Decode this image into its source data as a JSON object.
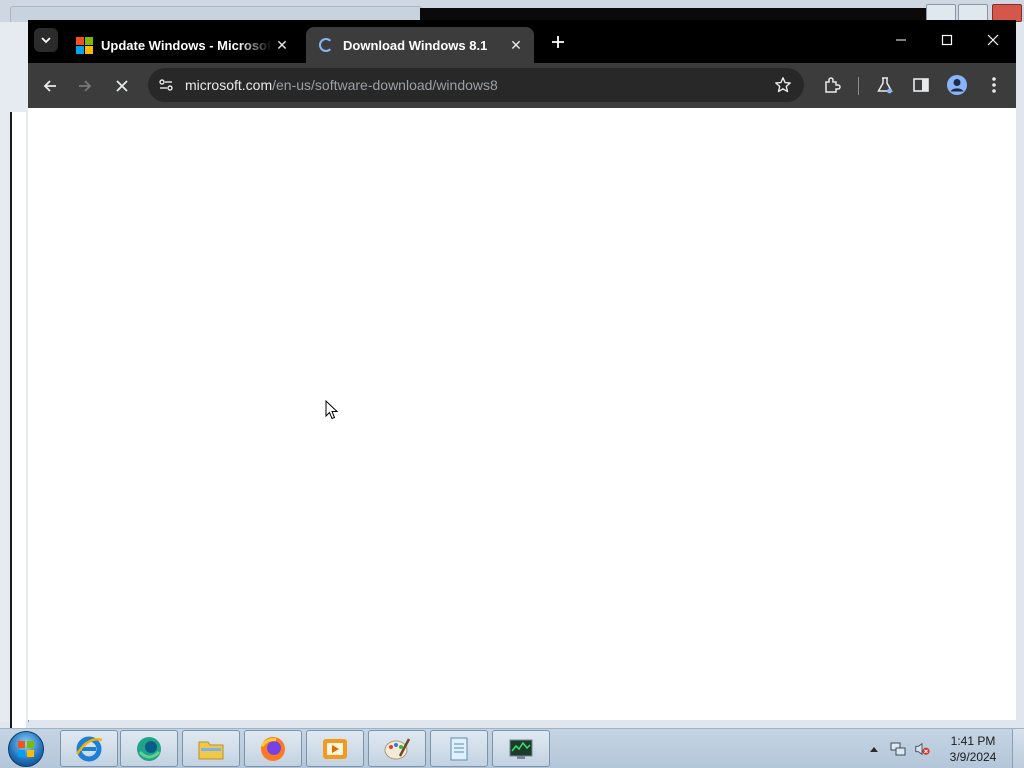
{
  "browser": {
    "tabs": [
      {
        "title": "Update Windows - Microsoft S",
        "favicon": "microsoft-logo-icon",
        "active": false
      },
      {
        "title": "Download Windows 8.1",
        "favicon": "loading-spinner-icon",
        "active": true
      }
    ],
    "address": {
      "host": "microsoft.com",
      "path": "/en-us/software-download/windows8"
    },
    "toolbar_icons": [
      "back-arrow-icon",
      "forward-arrow-icon",
      "stop-loading-icon",
      "site-info-icon",
      "bookmark-star-icon",
      "extensions-icon",
      "labs-flask-icon",
      "side-panel-icon",
      "profile-icon",
      "more-menu-icon"
    ]
  },
  "taskbar": {
    "pinned": [
      "internet-explorer-icon",
      "edge-icon",
      "file-explorer-icon",
      "firefox-icon",
      "media-player-icon",
      "paint-icon",
      "notepad-icon",
      "task-manager-icon"
    ],
    "clock": {
      "time": "1:41 PM",
      "date": "3/9/2024"
    }
  },
  "colors": {
    "tabstrip": "#000000",
    "active_tab": "#3c3c3c",
    "toolbar": "#3c3c3c",
    "omnibox": "#282828",
    "taskbar": "#bccbdb"
  }
}
